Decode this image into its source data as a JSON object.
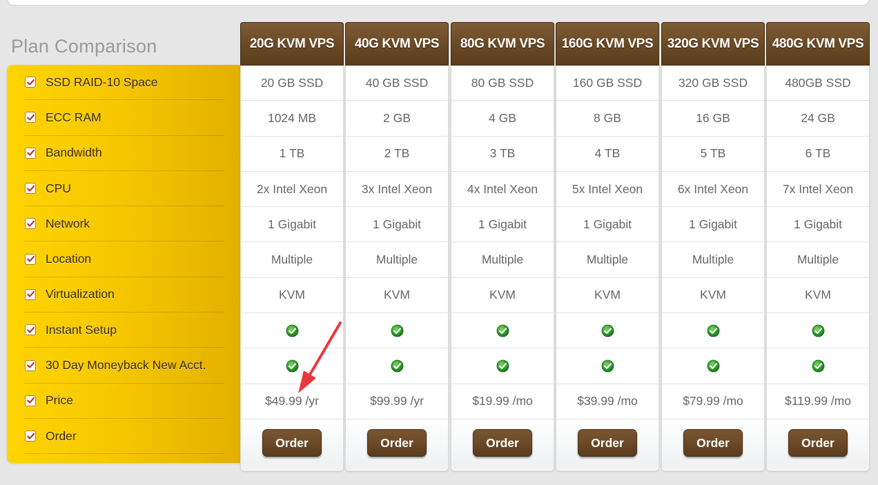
{
  "section_title": "Plan Comparison",
  "features": [
    "SSD RAID-10 Space",
    "ECC RAM",
    "Bandwidth",
    "CPU",
    "Network",
    "Location",
    "Virtualization",
    "Instant Setup",
    "30 Day Moneyback New Acct.",
    "Price",
    "Order"
  ],
  "plans": [
    {
      "name": "20G KVM VPS",
      "space": "20 GB SSD",
      "ram": "1024 MB",
      "bandwidth": "1 TB",
      "cpu": "2x Intel Xeon",
      "network": "1 Gigabit",
      "location": "Multiple",
      "virtualization": "KVM",
      "price": "$49.99 /yr",
      "order_label": "Order"
    },
    {
      "name": "40G KVM VPS",
      "space": "40 GB SSD",
      "ram": "2 GB",
      "bandwidth": "2 TB",
      "cpu": "3x Intel Xeon",
      "network": "1 Gigabit",
      "location": "Multiple",
      "virtualization": "KVM",
      "price": "$99.99 /yr",
      "order_label": "Order"
    },
    {
      "name": "80G KVM VPS",
      "space": "80 GB SSD",
      "ram": "4 GB",
      "bandwidth": "3 TB",
      "cpu": "4x Intel Xeon",
      "network": "1 Gigabit",
      "location": "Multiple",
      "virtualization": "KVM",
      "price": "$19.99 /mo",
      "order_label": "Order"
    },
    {
      "name": "160G KVM VPS",
      "space": "160 GB SSD",
      "ram": "8 GB",
      "bandwidth": "4 TB",
      "cpu": "5x Intel Xeon",
      "network": "1 Gigabit",
      "location": "Multiple",
      "virtualization": "KVM",
      "price": "$39.99 /mo",
      "order_label": "Order"
    },
    {
      "name": "320G KVM VPS",
      "space": "320 GB SSD",
      "ram": "16 GB",
      "bandwidth": "5 TB",
      "cpu": "6x Intel Xeon",
      "network": "1 Gigabit",
      "location": "Multiple",
      "virtualization": "KVM",
      "price": "$79.99 /mo",
      "order_label": "Order"
    },
    {
      "name": "480G KVM VPS",
      "space": "480GB SSD",
      "ram": "24 GB",
      "bandwidth": "6 TB",
      "cpu": "7x Intel Xeon",
      "network": "1 Gigabit",
      "location": "Multiple",
      "virtualization": "KVM",
      "price": "$119.99 /mo",
      "order_label": "Order"
    }
  ],
  "icons": {
    "feature_check": "checkbox-checked-icon",
    "included": "green-check-icon",
    "annotation": "red-arrow-annotation"
  },
  "colors": {
    "header_brown": "#6b4a26",
    "feature_gold": "#ffd400",
    "check_green": "#1e8a1e",
    "arrow_red": "#e8383d"
  }
}
